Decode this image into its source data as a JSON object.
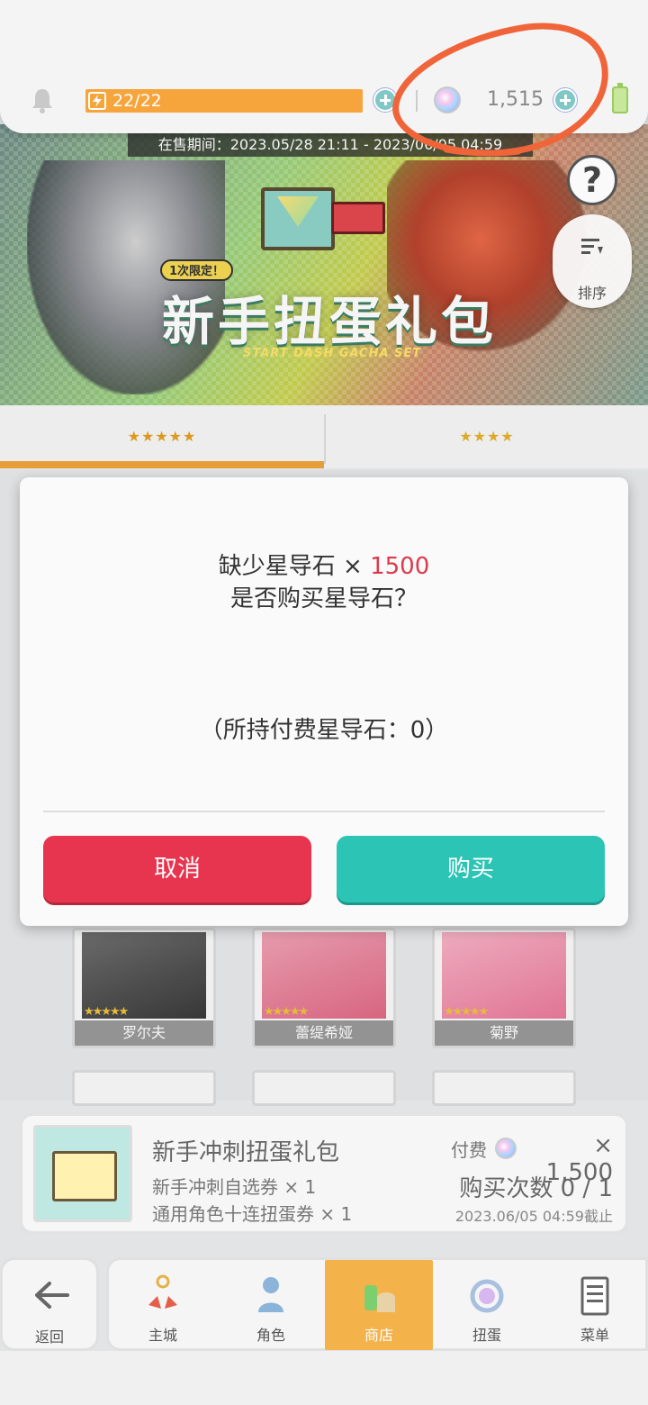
{
  "topbar": {
    "stamina": "22/22",
    "gems": "1,515"
  },
  "banner": {
    "sale_period": "在售期间：2023.05/28 21:11 - 2023/06/05 04:59",
    "limited_badge": "1次限定！",
    "title": "新手扭蛋礼包",
    "subtitle": "START DASH GACHA SET",
    "help_label": "?",
    "sort_label": "排序"
  },
  "tabs": [
    {
      "label": "★★★★★"
    },
    {
      "label": "★★★★"
    }
  ],
  "characters": [
    {
      "name": "罗尔夫",
      "stars": "★★★★★"
    },
    {
      "name": "蕾缇希娅",
      "stars": "★★★★★"
    },
    {
      "name": "菊野",
      "stars": "★★★★★"
    }
  ],
  "dialog": {
    "line1_prefix": "缺少星导石 × ",
    "line1_amount": "1500",
    "line2": "是否购买星导石？",
    "owned": "（所持付费星导石：0）",
    "cancel_label": "取消",
    "buy_label": "购买"
  },
  "product": {
    "name": "新手冲刺扭蛋礼包",
    "item1": "新手冲刺自选券 × 1",
    "item2": "通用角色十连扭蛋券 × 1",
    "pay_label": "付费",
    "price": "× 1,500",
    "purchase_count": "购买次数 0 / 1",
    "deadline": "2023.06/05 04:59截止"
  },
  "nav": {
    "back": "返回",
    "items": [
      {
        "label": "主城"
      },
      {
        "label": "角色"
      },
      {
        "label": "商店"
      },
      {
        "label": "扭蛋"
      },
      {
        "label": "菜单"
      }
    ]
  },
  "colors": {
    "accent_orange": "#f1a43b",
    "cancel_red": "#e8354f",
    "buy_teal": "#2cc4b4",
    "amount_red": "#dc3a4c",
    "annotation_circle": "#f0643a"
  }
}
